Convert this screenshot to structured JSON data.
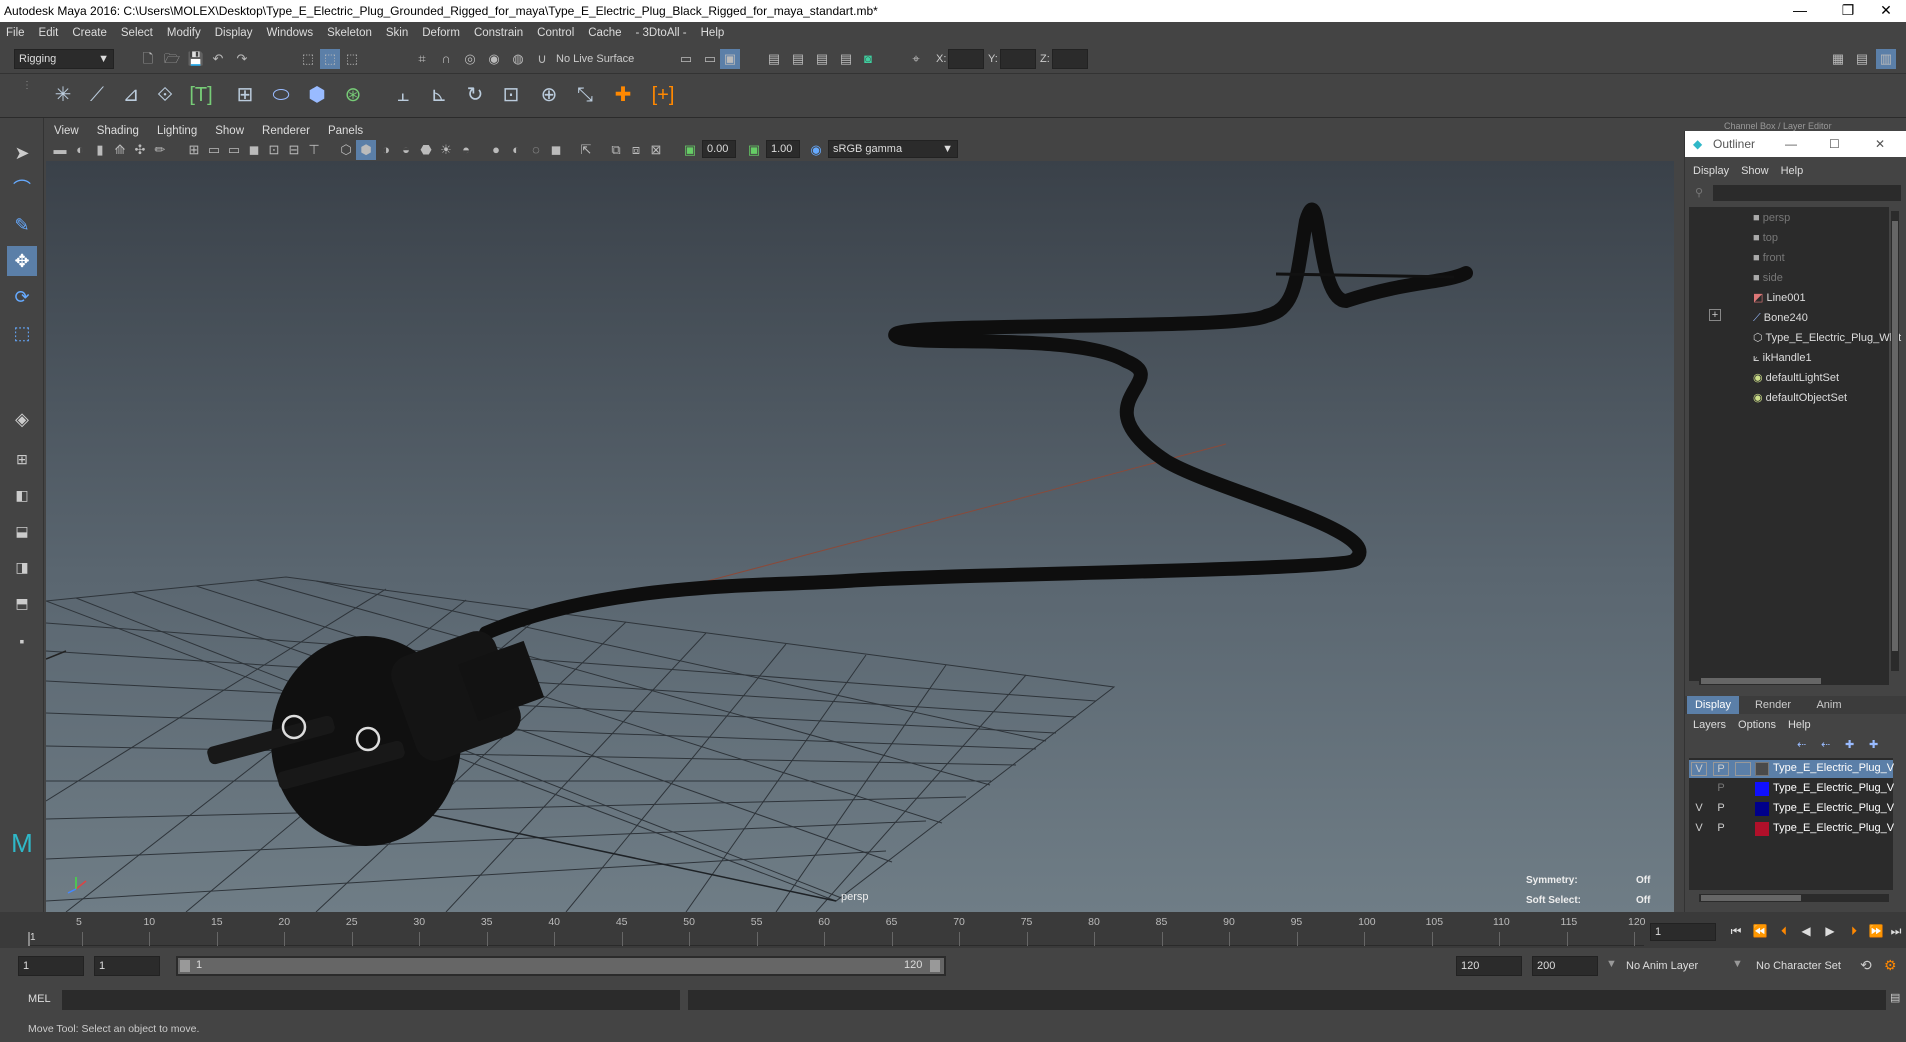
{
  "window": {
    "title": "Autodesk Maya 2016: C:\\Users\\MOLEX\\Desktop\\Type_E_Electric_Plug_Grounded_Rigged_for_maya\\Type_E_Electric_Plug_Black_Rigged_for_maya_standart.mb*",
    "minimize": "—",
    "restore": "❐",
    "close": "✕"
  },
  "menubar": [
    "File",
    "Edit",
    "Create",
    "Select",
    "Modify",
    "Display",
    "Windows",
    "Skeleton",
    "Skin",
    "Deform",
    "Constrain",
    "Control",
    "Cache",
    "- 3DtoAll -",
    "Help"
  ],
  "status": {
    "menuset": "Rigging",
    "live_surface": "No Live Surface",
    "x_label": "X:",
    "y_label": "Y:",
    "z_label": "Z:"
  },
  "viewport": {
    "menus": [
      "View",
      "Shading",
      "Lighting",
      "Show",
      "Renderer",
      "Panels"
    ],
    "exposure": "0.00",
    "gamma": "1.00",
    "color_space": "sRGB gamma",
    "camera_label": "persp",
    "symmetry_label": "Symmetry:",
    "symmetry_value": "Off",
    "soft_select_label": "Soft Select:",
    "soft_select_value": "Off"
  },
  "outliner": {
    "header_partial": "Channel Box / Layer Editor",
    "title": "Outliner",
    "menus": [
      "Display",
      "Show",
      "Help"
    ],
    "items": [
      {
        "label": "persp",
        "icon": "camera-icon",
        "dim": true
      },
      {
        "label": "top",
        "icon": "camera-icon",
        "dim": true
      },
      {
        "label": "front",
        "icon": "camera-icon",
        "dim": true
      },
      {
        "label": "side",
        "icon": "camera-icon",
        "dim": true
      },
      {
        "label": "Line001",
        "icon": "curve-icon",
        "dim": false
      },
      {
        "label": "Bone240",
        "icon": "joint-icon",
        "dim": false,
        "expandable": true
      },
      {
        "label": "Type_E_Electric_Plug_Whit",
        "icon": "mesh-icon",
        "dim": false
      },
      {
        "label": "ikHandle1",
        "icon": "ik-handle-icon",
        "dim": false
      },
      {
        "label": "defaultLightSet",
        "icon": "set-icon",
        "dim": false
      },
      {
        "label": "defaultObjectSet",
        "icon": "set-icon",
        "dim": false
      }
    ]
  },
  "layers": {
    "tabs": [
      "Display",
      "Render",
      "Anim"
    ],
    "menus": [
      "Layers",
      "Options",
      "Help"
    ],
    "rows": [
      {
        "v": "V",
        "p": "P",
        "color": "#4a4a4a",
        "name": "Type_E_Electric_Plug_V",
        "selected": true
      },
      {
        "v": "",
        "p": "P",
        "color": "#1010ff",
        "name": "Type_E_Electric_Plug_V",
        "selected": false
      },
      {
        "v": "V",
        "p": "P",
        "color": "#00008b",
        "name": "Type_E_Electric_Plug_V",
        "selected": false
      },
      {
        "v": "V",
        "p": "P",
        "color": "#b0102a",
        "name": "Type_E_Electric_Plug_V",
        "selected": false
      }
    ]
  },
  "timeline": {
    "ticks": [
      "5",
      "10",
      "15",
      "20",
      "25",
      "30",
      "35",
      "40",
      "45",
      "50",
      "55",
      "60",
      "65",
      "70",
      "75",
      "80",
      "85",
      "90",
      "95",
      "100",
      "105",
      "110",
      "115",
      "120"
    ],
    "start_tick": "1",
    "current_frame": "1"
  },
  "range": {
    "start": "1",
    "playback_start": "1",
    "slider_start": "1",
    "slider_end": "120",
    "playback_end": "120",
    "end": "200",
    "anim_layer": "No Anim Layer",
    "character_set": "No Character Set"
  },
  "command": {
    "label": "MEL"
  },
  "help_line": "Move Tool: Select an object to move."
}
